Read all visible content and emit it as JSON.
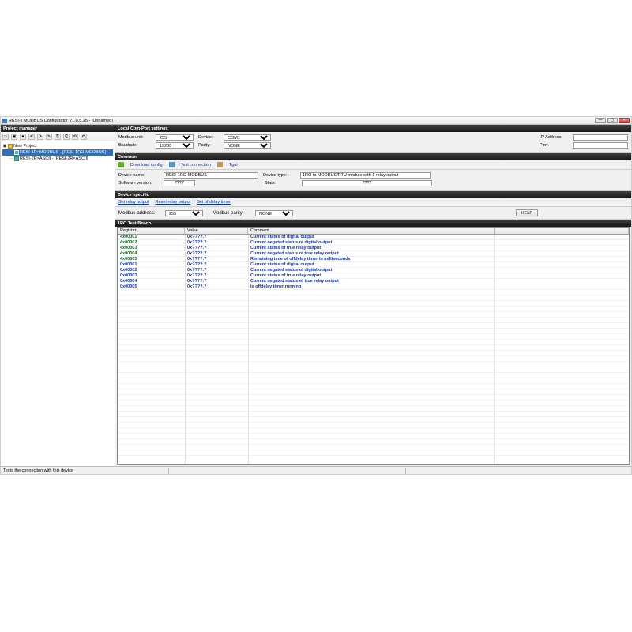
{
  "window": {
    "title": "RESI-x MODBUS Configurator V1.0.5.25 - [Unnamed]",
    "min": "—",
    "max": "▢",
    "close": "✕"
  },
  "project_manager": {
    "header": "Project manager",
    "toolbar_icons": [
      "□",
      "▣",
      "■",
      "↶",
      "↷",
      "✎",
      "⎘",
      "⎗",
      "⚙",
      "✿"
    ],
    "root": {
      "label": "New Project"
    },
    "nodes": [
      {
        "label": "RESI-1R×MODBUS - [RESI-1RO-MODBUS]",
        "selected": true
      },
      {
        "label": "RESI-2R×ASCII - [RESI-2R×ASCII]",
        "selected": false
      }
    ]
  },
  "comport": {
    "header": "Local Com-Port settings",
    "modbus_unit_label": "Modbus unit:",
    "modbus_unit": "255",
    "device_label": "Device:",
    "device": "COM1",
    "baud_label": "Baudrate:",
    "baud": "19200",
    "parity_label": "Parity:",
    "parity": "NONE",
    "ip_label": "IP-Address:",
    "ip": "",
    "port_label": "Port:",
    "port": ""
  },
  "common": {
    "header": "Common",
    "download": "Download config",
    "test": "Test connection",
    "tgui": "Tgui",
    "devname_label": "Device name:",
    "devname": "RESI-1RO-MODBUS",
    "devtype_label": "Device type:",
    "devtype": "1RO to MODBUS/RTU module with 1 relay output",
    "sw_label": "Software version:",
    "sw": "????",
    "state_label": "State:",
    "state": "????"
  },
  "device_specific": {
    "header": "Device specific",
    "links": [
      "Set relay output",
      "Reset relay output",
      "Set offdelay timer"
    ],
    "modbus_addr_label": "Modbus-address:",
    "modbus_addr": "255",
    "modbus_parity_label": "Modbus parity:",
    "modbus_parity": "NONE",
    "help": "HELP"
  },
  "bench": {
    "header": "1RO Test Bench",
    "columns": {
      "reg": "Register",
      "val": "Value",
      "com": "Comment"
    },
    "rows": [
      {
        "reg": "4x00001",
        "regcolor": "green",
        "val": "0x????.?",
        "com": "Current status of digital output"
      },
      {
        "reg": "4x00002",
        "regcolor": "green",
        "val": "0x????.?",
        "com": "Current negated status of digital output"
      },
      {
        "reg": "4x00003",
        "regcolor": "green",
        "val": "0x????.?",
        "com": "Current status of true relay output"
      },
      {
        "reg": "4x00004",
        "regcolor": "green",
        "val": "0x????.?",
        "com": "Current negated status of true relay output"
      },
      {
        "reg": "4x00005",
        "regcolor": "green",
        "val": "0x????.?",
        "com": "Remaining time of offdelay timer in milliseconds"
      },
      {
        "reg": "0x00001",
        "regcolor": "blue",
        "val": "0x????.?",
        "com": "Current status of digital output"
      },
      {
        "reg": "0x00002",
        "regcolor": "blue",
        "val": "0x????.?",
        "com": "Current negated status of digital output"
      },
      {
        "reg": "0x00003",
        "regcolor": "blue",
        "val": "0x????.?",
        "com": "Current status of true relay output"
      },
      {
        "reg": "0x00004",
        "regcolor": "blue",
        "val": "0x????.?",
        "com": "Current negated status of true relay output"
      },
      {
        "reg": "0x00005",
        "regcolor": "blue",
        "val": "0x????.?",
        "com": "Is offdelay timer running"
      }
    ]
  },
  "status": {
    "text": "Tests the connection with this device"
  }
}
